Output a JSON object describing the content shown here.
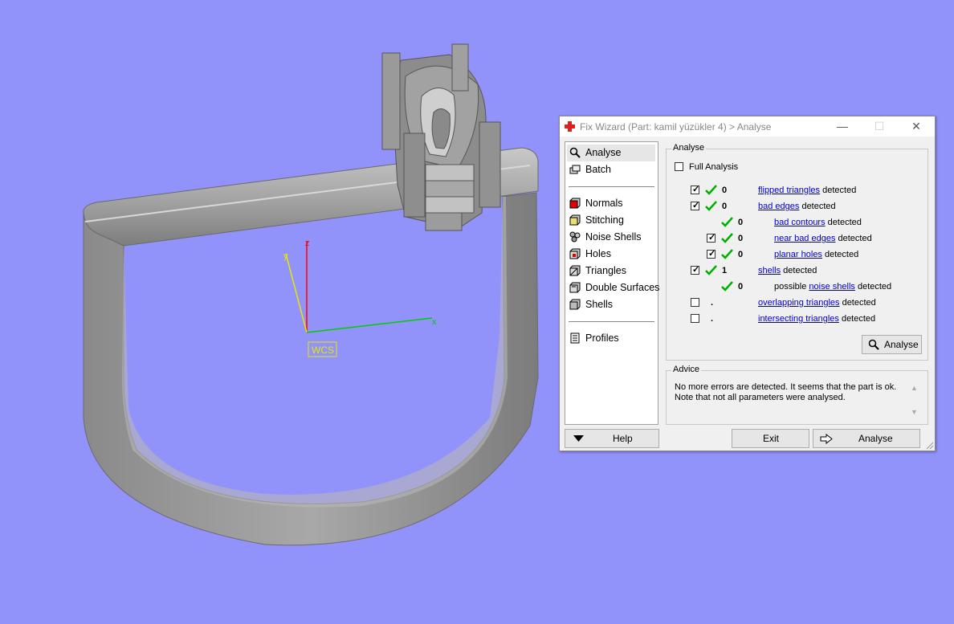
{
  "viewport": {
    "axes": {
      "x": "x",
      "y": "y",
      "z": "z"
    },
    "wcs_label": "WCS",
    "colors": {
      "background": "#9292fb",
      "model": "#9a9a9a",
      "x_axis": "#00cc00",
      "y_axis": "#e6e600",
      "z_axis": "#ff0000"
    }
  },
  "window": {
    "title": "Fix Wizard (Part: kamil yüzükler 4) > Analyse",
    "controls": {
      "minimize": "—",
      "maximize": "☐",
      "close": "✕"
    }
  },
  "sidebar": {
    "items": [
      {
        "label": "Analyse",
        "icon": "magnifier-icon",
        "selected": true
      },
      {
        "label": "Batch",
        "icon": "batch-icon"
      },
      {
        "label": "Normals",
        "icon": "normals-cube-icon"
      },
      {
        "label": "Stitching",
        "icon": "stitching-cube-icon"
      },
      {
        "label": "Noise Shells",
        "icon": "noise-shells-icon"
      },
      {
        "label": "Holes",
        "icon": "holes-cube-icon"
      },
      {
        "label": "Triangles",
        "icon": "triangles-cube-icon"
      },
      {
        "label": "Double Surfaces",
        "icon": "double-surfaces-cube-icon"
      },
      {
        "label": "Shells",
        "icon": "shells-cube-icon"
      },
      {
        "label": "Profiles",
        "icon": "profiles-icon"
      }
    ]
  },
  "analyse": {
    "group_title": "Analyse",
    "full_analysis": {
      "label": "Full Analysis",
      "checked": false
    },
    "rows": [
      {
        "checkbox": true,
        "checked": true,
        "ok": true,
        "count": "0",
        "prefix": "",
        "link": "flipped triangles",
        "suffix": "detected",
        "indent": 0
      },
      {
        "checkbox": true,
        "checked": true,
        "ok": true,
        "count": "0",
        "prefix": "",
        "link": "bad edges",
        "suffix": "detected",
        "indent": 0
      },
      {
        "checkbox": false,
        "checked": false,
        "ok": true,
        "count": "0",
        "prefix": "",
        "link": "bad contours",
        "suffix": "detected",
        "indent": 1
      },
      {
        "checkbox": true,
        "checked": true,
        "ok": true,
        "count": "0",
        "prefix": "",
        "link": "near bad edges",
        "suffix": "detected",
        "indent": 1
      },
      {
        "checkbox": true,
        "checked": true,
        "ok": true,
        "count": "0",
        "prefix": "",
        "link": "planar holes",
        "suffix": "detected",
        "indent": 1
      },
      {
        "checkbox": true,
        "checked": true,
        "ok": true,
        "count": "1",
        "prefix": "",
        "link": "shells",
        "suffix": "detected",
        "indent": 0
      },
      {
        "checkbox": false,
        "checked": false,
        "ok": true,
        "count": "0",
        "prefix": "possible",
        "link": "noise shells",
        "suffix": "detected",
        "indent": 1
      },
      {
        "checkbox": true,
        "checked": false,
        "ok": false,
        "count": ".",
        "prefix": "",
        "link": "overlapping triangles",
        "suffix": "detected",
        "indent": 0
      },
      {
        "checkbox": true,
        "checked": false,
        "ok": false,
        "count": ".",
        "prefix": "",
        "link": "intersecting triangles",
        "suffix": "detected",
        "indent": 0
      }
    ],
    "analyse_button": "Analyse"
  },
  "advice": {
    "group_title": "Advice",
    "text": "No more errors are detected. It seems that the part is ok.\nNote that not all parameters were analysed."
  },
  "footer": {
    "help": "Help",
    "exit": "Exit",
    "analyse": "Analyse"
  }
}
